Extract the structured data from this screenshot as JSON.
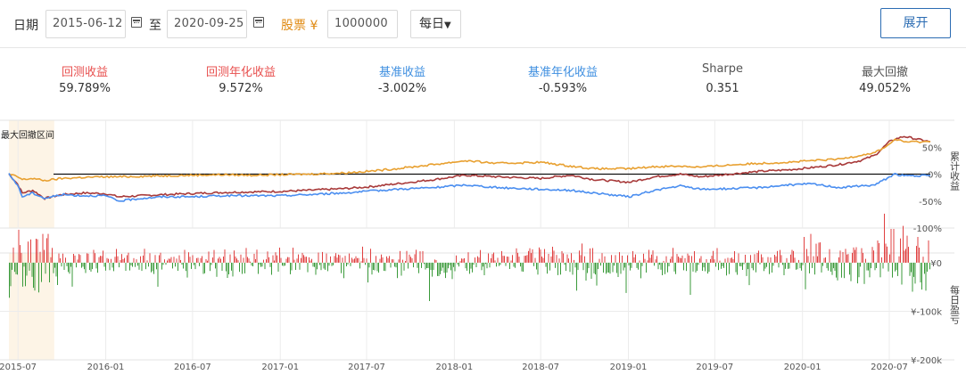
{
  "toolbar": {
    "date_label": "日期",
    "start_date": "2015-06-12",
    "to_label": "至",
    "end_date": "2020-09-25",
    "capital_label": "股票 ¥",
    "capital_value": "1000000",
    "period_select": "每日",
    "expand_label": "展开",
    "accent": "#2b6cb3",
    "capital_color": "#e08a12"
  },
  "stats": [
    {
      "label": "回测收益",
      "value": "59.789%",
      "color": "#e8504f"
    },
    {
      "label": "回测年化收益",
      "value": "9.572%",
      "color": "#e8504f"
    },
    {
      "label": "基准收益",
      "value": "-3.002%",
      "color": "#3f8fe0"
    },
    {
      "label": "基准年化收益",
      "value": "-0.593%",
      "color": "#3f8fe0"
    },
    {
      "label": "Sharpe",
      "value": "0.351",
      "color": "#555555"
    },
    {
      "label": "最大回撤",
      "value": "49.052%",
      "color": "#555555"
    }
  ],
  "chart_data": [
    {
      "type": "line",
      "title": "",
      "ylabel": "累计收益",
      "annotation": "最大回撤区间",
      "drawdown_range": [
        "2015-06-12",
        "2015-09-15"
      ],
      "y_ticks": [
        "50%",
        "0%",
        "-50%",
        "-100%"
      ],
      "ylim": [
        -1.0,
        1.0
      ],
      "x": [
        "2015-06-12",
        "2015-06-30",
        "2015-07-10",
        "2015-08-01",
        "2015-08-26",
        "2015-10-01",
        "2015-11-15",
        "2015-12-31",
        "2016-01-28",
        "2016-03-15",
        "2016-05-01",
        "2016-07-01",
        "2016-09-01",
        "2016-11-01",
        "2017-01-01",
        "2017-03-01",
        "2017-05-10",
        "2017-07-01",
        "2017-09-01",
        "2017-11-20",
        "2018-01-24",
        "2018-04-01",
        "2018-07-01",
        "2018-09-01",
        "2018-10-20",
        "2019-01-03",
        "2019-02-25",
        "2019-04-20",
        "2019-06-01",
        "2019-08-01",
        "2019-10-01",
        "2019-12-01",
        "2020-01-20",
        "2020-03-20",
        "2020-05-01",
        "2020-06-01",
        "2020-07-01",
        "2020-07-13",
        "2020-08-01",
        "2020-09-25"
      ],
      "series": [
        {
          "name": "",
          "color": "#a83a3a",
          "values": [
            0.0,
            -0.18,
            -0.35,
            -0.3,
            -0.45,
            -0.38,
            -0.35,
            -0.36,
            -0.42,
            -0.4,
            -0.38,
            -0.36,
            -0.34,
            -0.33,
            -0.32,
            -0.3,
            -0.27,
            -0.24,
            -0.18,
            -0.1,
            -0.02,
            -0.05,
            -0.08,
            -0.02,
            -0.1,
            -0.15,
            -0.05,
            0.0,
            -0.05,
            0.0,
            0.05,
            0.08,
            0.12,
            0.18,
            0.25,
            0.35,
            0.6,
            0.65,
            0.7,
            0.6
          ]
        },
        {
          "name": "",
          "color": "#e8a030",
          "values": [
            0.0,
            -0.05,
            -0.1,
            -0.08,
            -0.12,
            -0.08,
            -0.06,
            -0.05,
            -0.05,
            -0.04,
            -0.03,
            -0.02,
            -0.01,
            -0.02,
            -0.01,
            0.0,
            0.02,
            0.05,
            0.1,
            0.18,
            0.25,
            0.2,
            0.22,
            0.15,
            0.1,
            0.1,
            0.14,
            0.15,
            0.13,
            0.17,
            0.2,
            0.22,
            0.25,
            0.28,
            0.35,
            0.4,
            0.55,
            0.65,
            0.6,
            0.6
          ]
        },
        {
          "name": "",
          "color": "#4a8ef0",
          "values": [
            0.0,
            -0.2,
            -0.42,
            -0.35,
            -0.45,
            -0.38,
            -0.4,
            -0.4,
            -0.5,
            -0.45,
            -0.42,
            -0.42,
            -0.4,
            -0.4,
            -0.4,
            -0.38,
            -0.35,
            -0.32,
            -0.28,
            -0.25,
            -0.2,
            -0.25,
            -0.28,
            -0.3,
            -0.35,
            -0.42,
            -0.3,
            -0.22,
            -0.28,
            -0.27,
            -0.25,
            -0.2,
            -0.18,
            -0.25,
            -0.22,
            -0.2,
            -0.05,
            0.0,
            -0.03,
            -0.03
          ]
        }
      ]
    },
    {
      "type": "bar",
      "title": "",
      "ylabel": "每日盈亏",
      "y_ticks": [
        "¥0",
        "¥-100k",
        "¥-200k"
      ],
      "ylim": [
        -200000,
        20000
      ],
      "positive_color": "#e04040",
      "negative_color": "#3a9a3a",
      "x_ticks": [
        "2015-07",
        "2016-01",
        "2016-07",
        "2017-01",
        "2017-07",
        "2018-01",
        "2018-07",
        "2019-01",
        "2019-07",
        "2020-01",
        "2020-07"
      ]
    }
  ]
}
